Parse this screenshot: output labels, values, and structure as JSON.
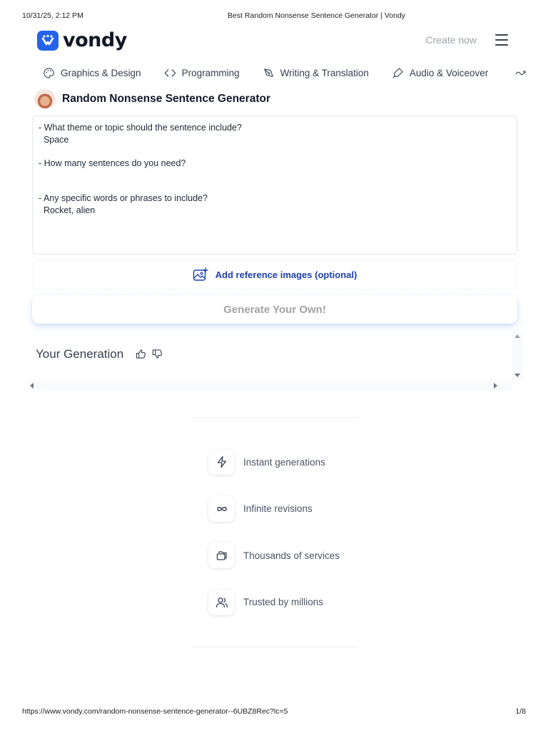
{
  "print": {
    "datetime": "10/31/25, 2:12 PM",
    "doc_title": "Best Random Nonsense Sentence Generator | Vondy",
    "url": "https://www.vondy.com/random-nonsense-sentence-generator--6UBZ8Rec?lc=5",
    "page": "1/8"
  },
  "header": {
    "logo_text": "vondy",
    "create_now": "Create now",
    "menu_icon": "hamburger-icon"
  },
  "categories": [
    {
      "label": "Graphics & Design",
      "icon": "palette-icon"
    },
    {
      "label": "Programming",
      "icon": "code-icon"
    },
    {
      "label": "Writing & Translation",
      "icon": "pen-icon"
    },
    {
      "label": "Audio & Voiceover",
      "icon": "microphone-icon"
    }
  ],
  "tool": {
    "title": "Random Nonsense Sentence Generator",
    "prompt": "- What theme or topic should the sentence include?\n  Space\n\n- How many sentences do you need?\n\n\n- Any specific words or phrases to include?\n  Rocket, alien",
    "add_reference": "Add reference images (optional)",
    "generate": "Generate Your Own!"
  },
  "generation": {
    "title": "Your Generation"
  },
  "features": [
    {
      "label": "Instant generations",
      "icon": "lightning-icon"
    },
    {
      "label": "Infinite revisions",
      "icon": "infinity-icon"
    },
    {
      "label": "Thousands of services",
      "icon": "layers-icon"
    },
    {
      "label": "Trusted by millions",
      "icon": "users-icon"
    }
  ],
  "colors": {
    "brand": "#2563eb",
    "link": "#1e40af"
  }
}
